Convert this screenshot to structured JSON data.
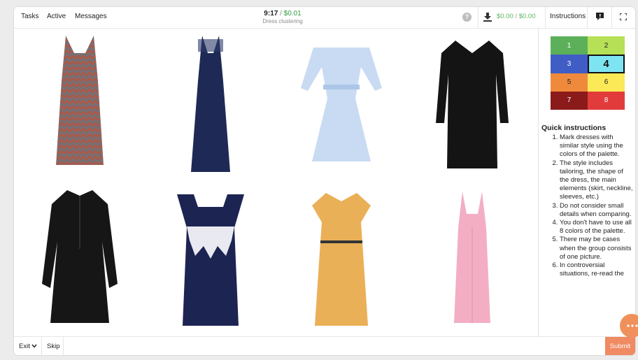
{
  "topbar": {
    "nav": [
      "Tasks",
      "Active",
      "Messages"
    ],
    "timer": "9:17",
    "timer_sep": " / ",
    "price": "$0.01",
    "task_title": "Dress clustering",
    "help_glyph": "?",
    "balance_a": "$0.00",
    "balance_sep": " / ",
    "balance_b": "$0.00",
    "instructions_label": "Instructions"
  },
  "dresses": [
    {
      "color": "#7a6e72",
      "accent": "#b7543e"
    },
    {
      "color": "#1e2a55",
      "accent": "#2d3a6b"
    },
    {
      "color": "#c9dbf2",
      "accent": "#adc6e8"
    },
    {
      "color": "#141414",
      "accent": "#2a2a2a"
    },
    {
      "color": "#161616",
      "accent": "#2b2b2b"
    },
    {
      "color": "#1c2452",
      "accent": "#e9e9f2"
    },
    {
      "color": "#eab057",
      "accent": "#333333"
    },
    {
      "color": "#f3aec4",
      "accent": "#e58fae"
    }
  ],
  "palette": [
    {
      "label": "1",
      "color": "#5cb05a",
      "text": "#ffffff"
    },
    {
      "label": "2",
      "color": "#b6e055",
      "text": "#222222"
    },
    {
      "label": "3",
      "color": "#3f5dc4",
      "text": "#ffffff"
    },
    {
      "label": "4",
      "color": "#7fe4f2",
      "text": "#111111",
      "active": true
    },
    {
      "label": "5",
      "color": "#ef8a3c",
      "text": "#222222"
    },
    {
      "label": "6",
      "color": "#fbe957",
      "text": "#222222"
    },
    {
      "label": "7",
      "color": "#8b1a1a",
      "text": "#ffffff"
    },
    {
      "label": "8",
      "color": "#e23b3b",
      "text": "#ffffff"
    }
  ],
  "instructions": {
    "title": "Quick instructions",
    "items": [
      "Mark dresses with similar style using the colors of the palette.",
      "The style includes tailoring, the shape of the dress, the main elements (skirt, neckline, sleeves, etc.)",
      "Do not consider small details when comparing.",
      "You don't have to use all 8 colors of the palette.",
      "There may be cases when the group consists of one picture.",
      "In controversial situations, re-read the"
    ]
  },
  "bottombar": {
    "exit_label": "Exit",
    "skip_label": "Skip",
    "submit_label": "Submit"
  },
  "icons": {
    "download": "download-icon",
    "message": "message-icon",
    "fullscreen": "fullscreen-icon",
    "chat": "chat-icon"
  }
}
